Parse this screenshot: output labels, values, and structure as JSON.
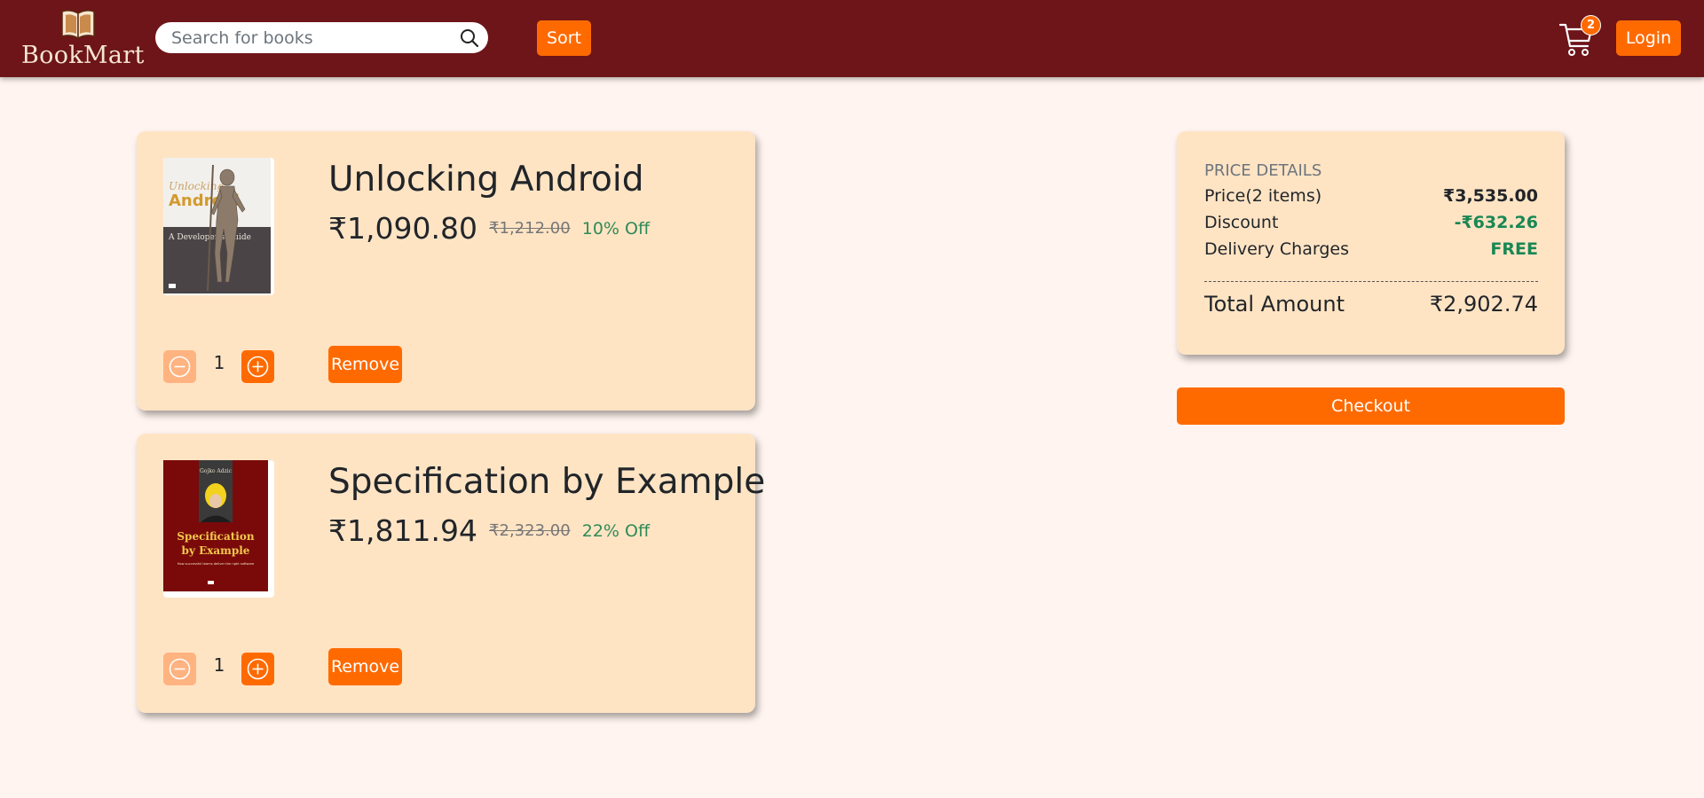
{
  "brand": {
    "name": "BookMart",
    "logo_icon": "book-icon"
  },
  "search": {
    "placeholder": "Search for books",
    "value": ""
  },
  "nav": {
    "sort_label": "Sort",
    "cart_count": "2",
    "login_label": "Login"
  },
  "cart_items": [
    {
      "title": "Unlocking Android",
      "price": "₹1,090.80",
      "mrp": "₹1,212.00",
      "discount": "10% Off",
      "quantity": "1",
      "remove_label": "Remove",
      "cover": {
        "title_line1": "Unlocking",
        "title_line2": "Android",
        "subtitle": "A Developer's Guide"
      }
    },
    {
      "title": "Specification by Example",
      "price": "₹1,811.94",
      "mrp": "₹2,323.00",
      "discount": "22% Off",
      "quantity": "1",
      "remove_label": "Remove",
      "cover": {
        "author": "Gojko Adzic",
        "title_line1": "Specification",
        "title_line2": "by Example",
        "subtitle": "How successful teams deliver the right software"
      }
    }
  ],
  "price_details": {
    "heading": "PRICE DETAILS",
    "price_label": "Price(2 items)",
    "price_value": "₹3,535.00",
    "discount_label": "Discount",
    "discount_value": "-₹632.26",
    "delivery_label": "Delivery Charges",
    "delivery_value": "FREE",
    "total_label": "Total Amount",
    "total_value": "₹2,902.74"
  },
  "checkout_label": "Checkout",
  "colors": {
    "header": "#6d1519",
    "accent": "#ff6a00",
    "card": "#ffe4c4",
    "background": "#fff4ef",
    "discount_green": "#198754"
  }
}
